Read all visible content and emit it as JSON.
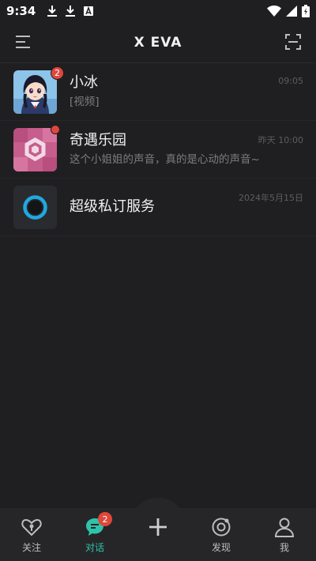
{
  "status_bar": {
    "time": "9:34",
    "left_icons": [
      "download-icon",
      "download-icon",
      "text-a-icon"
    ],
    "right_icons": [
      "wifi-icon",
      "cellular-signal-icon",
      "battery-charging-icon"
    ]
  },
  "header": {
    "title": "X EVA",
    "left_icon": "menu-icon",
    "right_icon": "scan-icon"
  },
  "conversations": [
    {
      "name": "小冰",
      "preview": "[视频]",
      "time": "09:05",
      "unread": "2",
      "avatar": "anime-girl-avatar"
    },
    {
      "name": "奇遇乐园",
      "preview": "这个小姐姐的声音，真的是心动的声音~",
      "time": "昨天 10:00",
      "unread_dot": true,
      "avatar": "hexagon-pink-avatar"
    },
    {
      "name": "超级私订服务",
      "preview": "",
      "time": "2024年5月15日",
      "avatar": "blue-ring-avatar"
    }
  ],
  "bottom_nav": [
    {
      "label": "关注",
      "icon": "heart-lock-icon",
      "active": false
    },
    {
      "label": "对话",
      "icon": "chat-bubble-icon",
      "active": true,
      "badge": "2"
    },
    {
      "label": "",
      "icon": "plus-icon",
      "active": false
    },
    {
      "label": "发现",
      "icon": "discover-icon",
      "active": false
    },
    {
      "label": "我",
      "icon": "profile-icon",
      "active": false
    }
  ],
  "colors": {
    "background": "#1f1f21",
    "nav_background": "#262628",
    "accent": "#2ec4a9",
    "badge": "#e0473c"
  }
}
